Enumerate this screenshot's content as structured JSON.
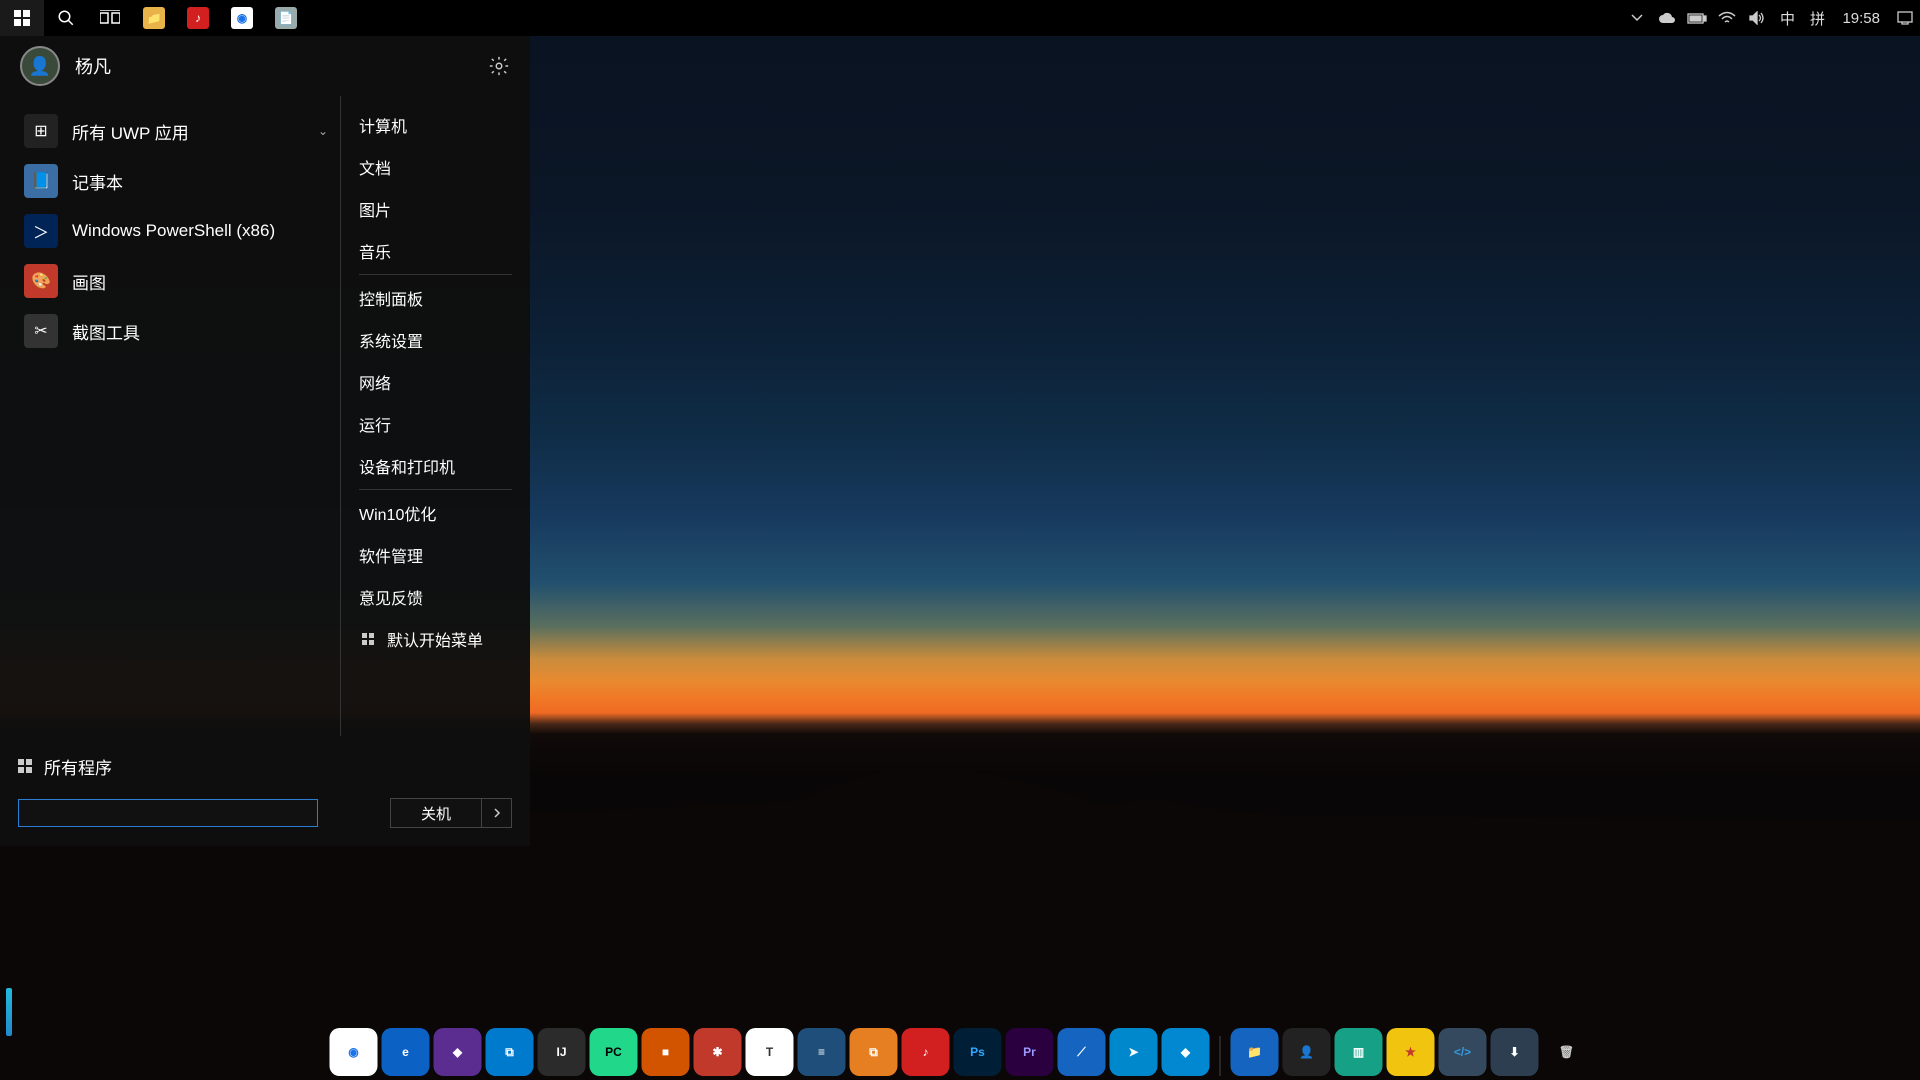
{
  "user": {
    "name": "杨凡"
  },
  "taskbar": {
    "pinned": [
      {
        "name": "file-explorer",
        "label": "📁",
        "bg": "#e8b44a"
      },
      {
        "name": "netease-music",
        "label": "♪",
        "bg": "#d21f1f"
      },
      {
        "name": "chrome",
        "label": "◉",
        "bg": "#ffffff"
      },
      {
        "name": "notepad",
        "label": "📄",
        "bg": "#9aa"
      }
    ],
    "clock": "19:58",
    "ime_lang": "中",
    "ime_mode": "拼"
  },
  "startmenu": {
    "apps": [
      {
        "id": "uwp",
        "label": "所有 UWP 应用",
        "icon_bg": "#222",
        "icon_txt": "⊞",
        "expandable": true
      },
      {
        "id": "notepad",
        "label": "记事本",
        "icon_bg": "#3a6ea5",
        "icon_txt": "📘"
      },
      {
        "id": "powershell",
        "label": "Windows PowerShell (x86)",
        "icon_bg": "#012456",
        "icon_txt": "＞"
      },
      {
        "id": "paint",
        "label": "画图",
        "icon_bg": "#c0392b",
        "icon_txt": "🎨"
      },
      {
        "id": "snip",
        "label": "截图工具",
        "icon_bg": "#333",
        "icon_txt": "✂"
      }
    ],
    "right_groups": [
      [
        "计算机",
        "文档",
        "图片",
        "音乐"
      ],
      [
        "控制面板",
        "系统设置",
        "网络",
        "运行",
        "设备和打印机"
      ],
      [
        "Win10优化",
        "软件管理",
        "意见反馈"
      ]
    ],
    "default_start": "默认开始菜单",
    "all_programs": "所有程序",
    "search_value": "",
    "power_label": "关机"
  },
  "dock": {
    "main": [
      {
        "name": "chrome",
        "bg": "#fff",
        "txt": "◉",
        "fg": "#1a73e8"
      },
      {
        "name": "edge",
        "bg": "#0b62c4",
        "txt": "e"
      },
      {
        "name": "visual-studio",
        "bg": "#5c2d91",
        "txt": "◆"
      },
      {
        "name": "vscode",
        "bg": "#007acc",
        "txt": "⧉"
      },
      {
        "name": "intellij",
        "bg": "#2b2b2b",
        "txt": "IJ"
      },
      {
        "name": "pycharm",
        "bg": "#21d789",
        "txt": "PC",
        "fg": "#000"
      },
      {
        "name": "app-orange",
        "bg": "#d35400",
        "txt": "■"
      },
      {
        "name": "xmind",
        "bg": "#c0392b",
        "txt": "✱"
      },
      {
        "name": "typora",
        "bg": "#fff",
        "txt": "T",
        "fg": "#333"
      },
      {
        "name": "app-blue",
        "bg": "#1e4e79",
        "txt": "≡"
      },
      {
        "name": "vmware",
        "bg": "#e67e22",
        "txt": "⧉"
      },
      {
        "name": "netease",
        "bg": "#d21f1f",
        "txt": "♪"
      },
      {
        "name": "photoshop",
        "bg": "#001e36",
        "txt": "Ps",
        "fg": "#31a8ff"
      },
      {
        "name": "premiere",
        "bg": "#2a003f",
        "txt": "Pr",
        "fg": "#9999ff"
      },
      {
        "name": "wireshark",
        "bg": "#1565c0",
        "txt": "⟋"
      },
      {
        "name": "telegram",
        "bg": "#0088cc",
        "txt": "➤"
      },
      {
        "name": "app-diamond",
        "bg": "#0288d1",
        "txt": "◆"
      }
    ],
    "extra": [
      {
        "name": "folder",
        "bg": "#1565c0",
        "txt": "📁"
      },
      {
        "name": "user-red",
        "bg": "#222",
        "txt": "👤",
        "fg": "#e74c3c"
      },
      {
        "name": "books",
        "bg": "#16a085",
        "txt": "▥"
      },
      {
        "name": "app-star",
        "bg": "#f1c40f",
        "txt": "★",
        "fg": "#c0392b"
      },
      {
        "name": "dev-tool",
        "bg": "#34495e",
        "txt": "</>",
        "fg": "#3498db"
      },
      {
        "name": "download",
        "bg": "#2c3e50",
        "txt": "⬇"
      },
      {
        "name": "recycle",
        "bg": "transparent",
        "txt": "🗑",
        "fg": "#ccc"
      }
    ]
  }
}
